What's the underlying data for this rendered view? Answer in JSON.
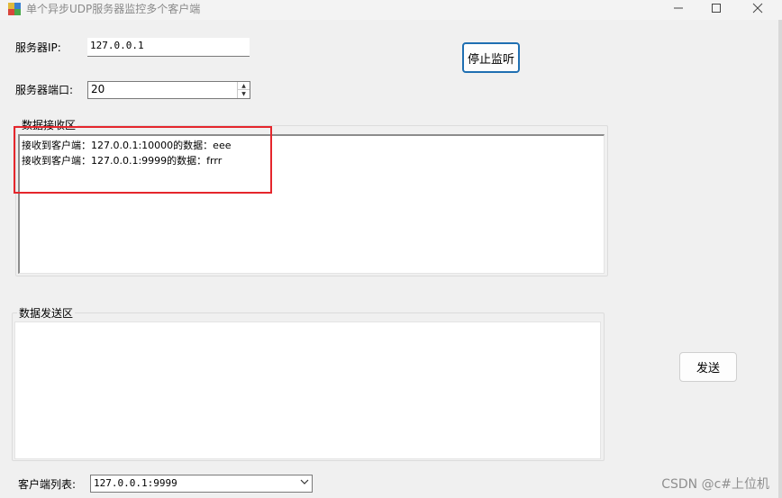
{
  "window": {
    "title": "单个异步UDP服务器监控多个客户端",
    "controls": {
      "minimize": "—",
      "maximize": "☐",
      "close": "✕"
    }
  },
  "server_ip": {
    "label": "服务器IP:",
    "value": "127.0.0.1"
  },
  "server_port": {
    "label": "服务器端口:",
    "value": "20"
  },
  "stop_button": {
    "label": "停止监听"
  },
  "receive_area": {
    "title": "数据接收区",
    "lines": [
      "接收到客户端：127.0.0.1:10000的数据：eee",
      "接收到客户端：127.0.0.1:9999的数据：frrr"
    ]
  },
  "send_area": {
    "title": "数据发送区",
    "value": ""
  },
  "send_button": {
    "label": "发送"
  },
  "client_list": {
    "label": "客户端列表:",
    "selected": "127.0.0.1:9999"
  },
  "watermark": "CSDN @c#上位机",
  "colors": {
    "highlight": "#e5262c",
    "focus_border": "#1f6fb2"
  },
  "icons": {
    "app": "app-window-icon",
    "dropdown": "chevron-down-icon"
  }
}
